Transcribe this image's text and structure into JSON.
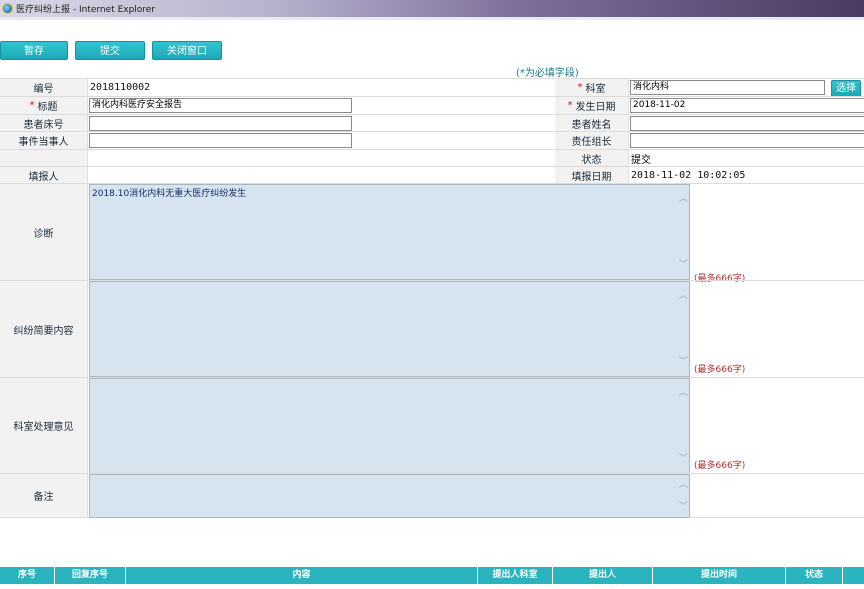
{
  "window": {
    "title": "医疗纠纷上报 - Internet Explorer"
  },
  "toolbar": {
    "save_label": "暂存",
    "submit_label": "提交",
    "close_label": "关闭窗口"
  },
  "required_hint": "(*为必填字段)",
  "form": {
    "number_label": "编号",
    "number_value": "2018110002",
    "dept_label": "科室",
    "dept_value": "消化内科",
    "select_label": "选择",
    "title_label": "标题",
    "title_value": "消化内科医疗安全报告",
    "date_label": "发生日期",
    "date_value": "2018-11-02",
    "bed_label": "患者床号",
    "bed_value": "",
    "patient_label": "患者姓名",
    "patient_value": "",
    "party_label": "事件当事人",
    "party_value": "",
    "leader_label": "责任组长",
    "leader_value": "",
    "status_label": "状态",
    "status_value": "提交",
    "filler_label": "填报人",
    "filler_value": "",
    "fill_date_label": "填报日期",
    "fill_date_value": "2018-11-02 10:02:05",
    "diagnosis_label": "诊断",
    "diagnosis_value": "2018.10消化内科无重大医疗纠纷发生",
    "summary_label": "纠纷简要内容",
    "summary_value": "",
    "opinion_label": "科室处理意见",
    "opinion_value": "",
    "remark_label": "备注",
    "remark_value": "",
    "max_note": "(最多666字)"
  },
  "grid": {
    "columns": [
      "序号",
      "回复序号",
      "内容",
      "提出人科室",
      "提出人",
      "提出时间",
      "状态"
    ]
  },
  "colors": {
    "accent": "#2ab4bf",
    "textarea_bg": "#d5e4ee",
    "required": "#d01010"
  },
  "icons": {
    "app": "ie-icon",
    "scroll_up": "chevron-up-icon",
    "scroll_down": "chevron-down-icon"
  }
}
